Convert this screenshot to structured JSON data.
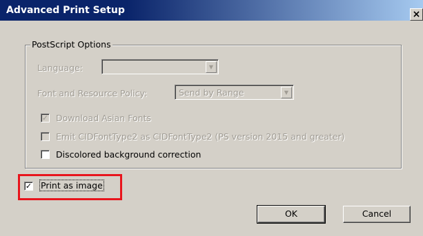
{
  "window": {
    "title": "Advanced Print Setup",
    "close_label": "×"
  },
  "postscript": {
    "group_label": "PostScript Options",
    "language_label": "Language:",
    "language_value": "",
    "font_policy_label": "Font and Resource Policy:",
    "font_policy_value": "Send by Range",
    "download_asian_label": "Download Asian Fonts",
    "download_asian_checked": true,
    "emit_cid_label": "Emit CIDFontType2 as CIDFontType2 (PS version 2015 and greater)",
    "emit_cid_checked": false,
    "discolored_label": "Discolored background correction",
    "discolored_checked": false
  },
  "print_as_image": {
    "label": "Print as image",
    "checked": true
  },
  "buttons": {
    "ok": "OK",
    "cancel": "Cancel"
  },
  "colors": {
    "highlight": "#e8141c",
    "titlebar": "#0a246a"
  }
}
